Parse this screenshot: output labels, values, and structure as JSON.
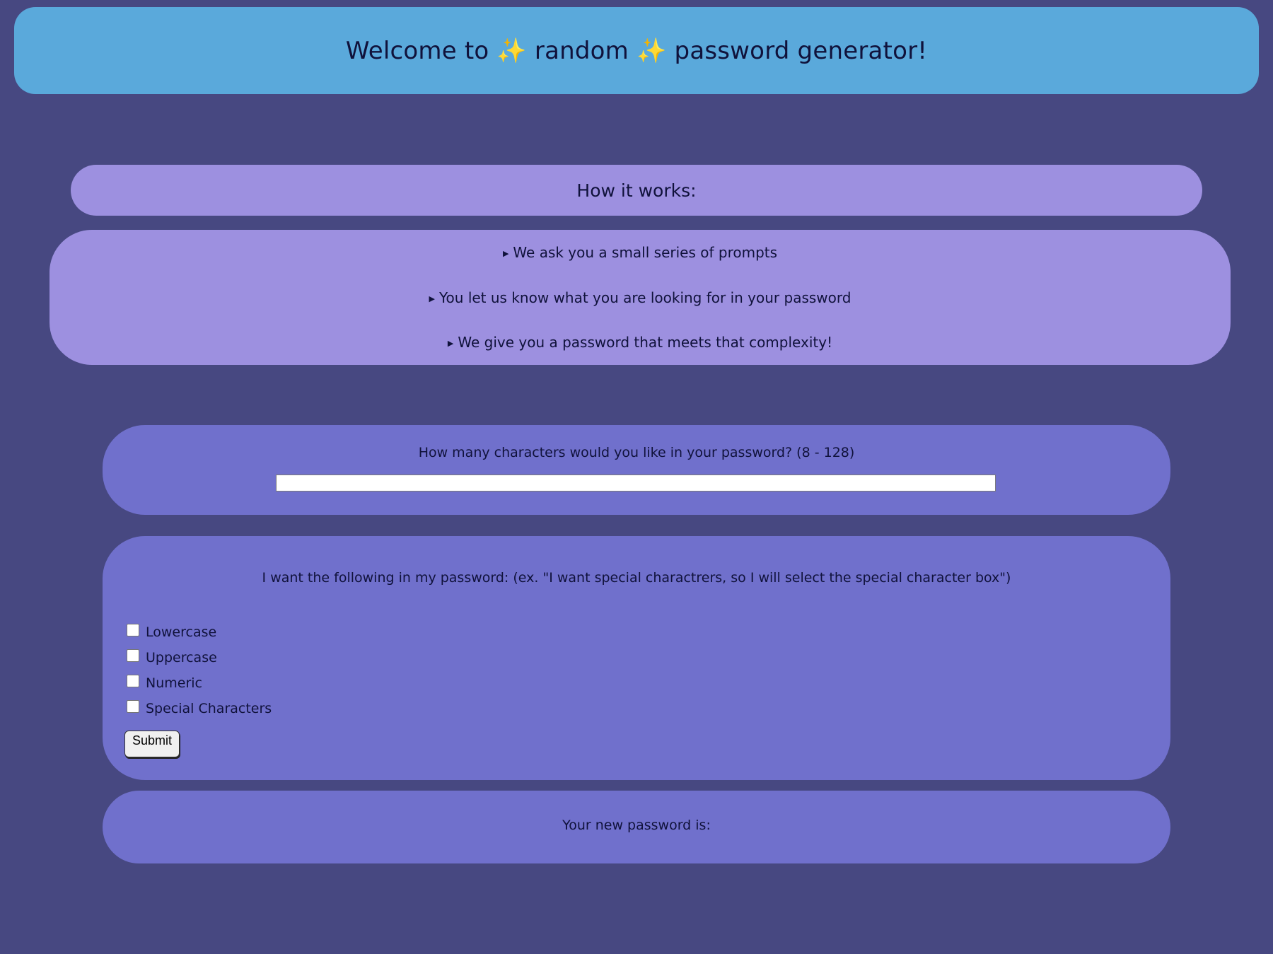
{
  "header": {
    "title": "Welcome to ✨ random ✨ password generator!"
  },
  "how_it_works": {
    "title": "How it works:",
    "items": [
      "We ask you a small series of prompts",
      "You let us know what you are looking for in your password",
      "We give you a password that meets that complexity!"
    ]
  },
  "length": {
    "question": "How many characters would you like in your password? (8 - 128)",
    "value": ""
  },
  "options": {
    "question": "I want the following in my password: (ex. \"I want special charactrers, so I will select the special character box\")",
    "choices": [
      {
        "label": "Lowercase",
        "checked": false
      },
      {
        "label": "Uppercase",
        "checked": false
      },
      {
        "label": "Numeric",
        "checked": false
      },
      {
        "label": "Special Characters",
        "checked": false
      }
    ],
    "submit_label": "Submit"
  },
  "result": {
    "label": "Your new password is:"
  },
  "colors": {
    "background": "#474881",
    "header": "#5aa9db",
    "info_panel": "#9d90e0",
    "form_panel": "#7070cc",
    "text": "#10123b"
  }
}
